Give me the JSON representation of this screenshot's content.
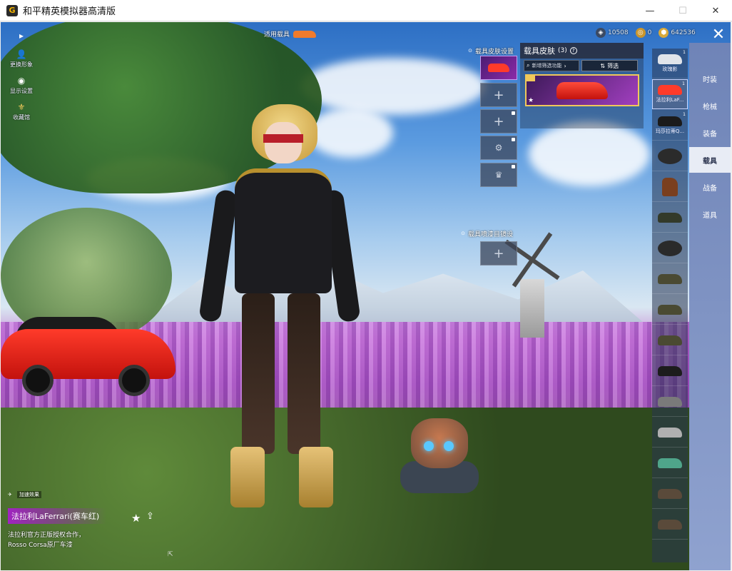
{
  "window": {
    "title": "和平精英模拟器高清版",
    "controls": {
      "minimize": "—",
      "maximize": "☐",
      "close": "✕"
    }
  },
  "hud_left": [
    {
      "icon": "play-icon",
      "glyph": "▸",
      "label": ""
    },
    {
      "icon": "person-icon",
      "glyph": "👤",
      "label": "更换形象"
    },
    {
      "icon": "eye-icon",
      "glyph": "◉",
      "label": "显示设置"
    },
    {
      "icon": "badge-icon",
      "glyph": "⚜",
      "label": "收藏馆"
    }
  ],
  "use_vehicle": {
    "label": "适用载具"
  },
  "currency": [
    {
      "icon": "coin-dark-icon",
      "value": "10508",
      "color": "#3b4a63"
    },
    {
      "icon": "coin-gold-icon",
      "value": "0",
      "color": "#c9952c"
    },
    {
      "icon": "shield-coin-icon",
      "value": "642536",
      "color": "#d8a93a"
    }
  ],
  "slots": {
    "header": "载具皮肤设置",
    "header2": "载具喷漆目镜设",
    "plus": "+"
  },
  "skin_panel": {
    "title": "载具皮肤",
    "count": "(3)",
    "help": "?",
    "search_placeholder": "新增筛选功能",
    "filter_label": "筛选"
  },
  "vehicles": [
    {
      "label": "玫瑰影",
      "sub": "1",
      "color": "#e0e4ea"
    },
    {
      "label": "法拉利LaF...",
      "sub": "1",
      "color": "#ff3b2a"
    },
    {
      "label": "玛莎拉蒂Q...",
      "sub": "1",
      "color": "#1b1b1b"
    },
    {
      "label": "",
      "sub": "",
      "color": "#2b2b2b"
    },
    {
      "label": "",
      "sub": "",
      "color": "#7a3f1e"
    },
    {
      "label": "",
      "sub": "",
      "color": "#333a2a"
    },
    {
      "label": "",
      "sub": "",
      "color": "#2a2a2a"
    },
    {
      "label": "",
      "sub": "",
      "color": "#4a4a32"
    },
    {
      "label": "",
      "sub": "",
      "color": "#4a4a32"
    },
    {
      "label": "",
      "sub": "",
      "color": "#4a4a32"
    },
    {
      "label": "",
      "sub": "",
      "color": "#1c1c1c"
    },
    {
      "label": "",
      "sub": "",
      "color": "#7a7a7a"
    },
    {
      "label": "",
      "sub": "",
      "color": "#b0b0b0"
    },
    {
      "label": "",
      "sub": "",
      "color": "#4fa58a"
    },
    {
      "label": "",
      "sub": "",
      "color": "#5a4a3a"
    },
    {
      "label": "",
      "sub": "",
      "color": "#5a4a3a"
    }
  ],
  "categories": [
    {
      "label": "时装"
    },
    {
      "label": "枪械"
    },
    {
      "label": "装备"
    },
    {
      "label": "载具"
    },
    {
      "label": "战备"
    },
    {
      "label": "道具"
    }
  ],
  "bottom": {
    "boost": "加速效果",
    "skin_name": "法拉利LaFerrari(赛车红)",
    "description": "法拉利官方正版授权合作，Rosso Corsa原厂车漆"
  },
  "colors": {
    "accent_purple": "#a024c0",
    "accent_gold": "#f0c85a",
    "sidebar": "#7f93c3"
  }
}
